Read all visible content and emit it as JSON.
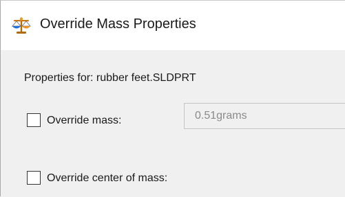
{
  "dialog": {
    "title": "Override Mass Properties",
    "icon": "mass-properties-scale-icon"
  },
  "properties": {
    "label": "Properties for: rubber feet.SLDPRT"
  },
  "override_mass": {
    "label": "Override mass:",
    "checked": false,
    "value": "0.51grams",
    "enabled": false
  },
  "override_center_of_mass": {
    "label": "Override center of mass:",
    "checked": false
  },
  "colors": {
    "title_bg": "#ffffff",
    "body_bg": "#f0f0f0",
    "disabled_text": "#8a8a8a"
  }
}
